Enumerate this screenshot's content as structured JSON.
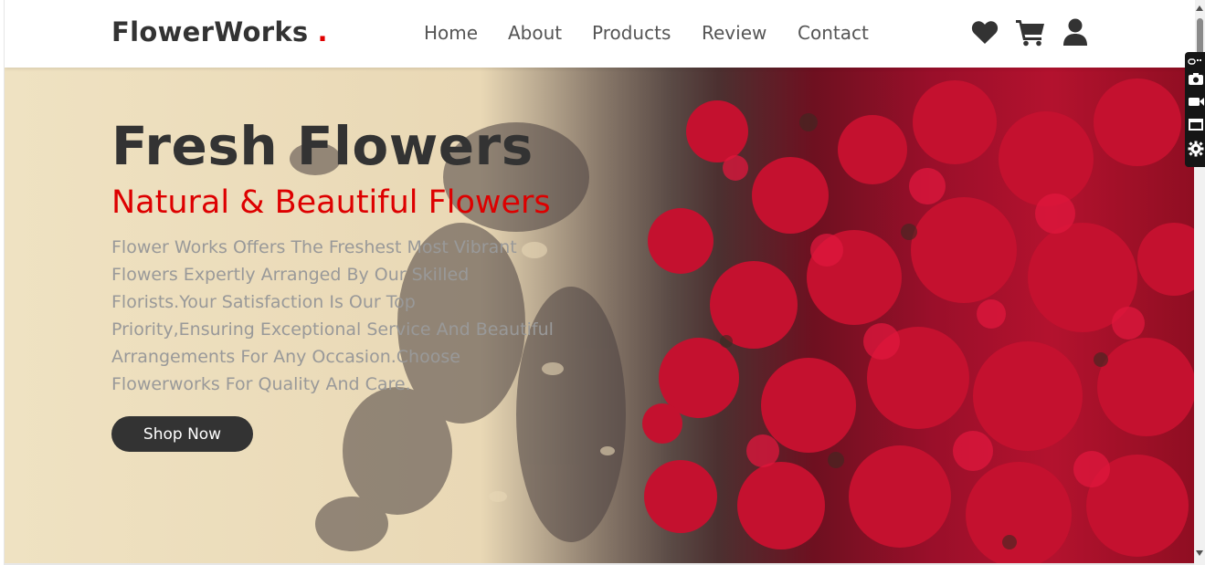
{
  "brand": {
    "name": "FlowerWorks",
    "dot": ".",
    "dot_color": "#e00000"
  },
  "nav": {
    "items": [
      {
        "label": "Home"
      },
      {
        "label": "About"
      },
      {
        "label": "Products"
      },
      {
        "label": "Review"
      },
      {
        "label": "Contact"
      }
    ]
  },
  "header_icons": [
    "heart-icon",
    "cart-icon",
    "user-icon"
  ],
  "hero": {
    "title": "Fresh Flowers",
    "subtitle": "Natural & Beautiful Flowers",
    "description": "Flower Works Offers The Freshest Most Vibrant Flowers Expertly Arranged By Our Skilled Florists.Your Satisfaction Is Our Top Priority,Ensuring Exceptional Service And Beautiful Arrangements For Any Occasion.Choose Flowerworks For Quality And Care.",
    "button_label": "Shop Now",
    "title_color": "#333333",
    "subtitle_color": "#dd0000",
    "text_color": "#999999",
    "button_color": "#333333"
  },
  "toolbar_icons": [
    "link-icon",
    "camera-icon",
    "video-icon",
    "window-icon",
    "gear-icon"
  ]
}
